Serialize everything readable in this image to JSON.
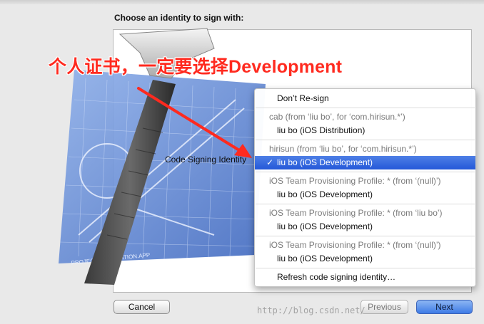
{
  "dialog": {
    "heading": "Choose an identity to sign with:",
    "field_label": "Code Signing Identity",
    "buttons": {
      "cancel": "Cancel",
      "previous": "Previous",
      "next": "Next"
    }
  },
  "annotation": {
    "text": "个人证书，一定要选择Development",
    "color": "#ff2a1f"
  },
  "menu": {
    "items": [
      {
        "kind": "option",
        "label": "Don’t Re-sign"
      },
      {
        "kind": "separator"
      },
      {
        "kind": "header",
        "label": "cab (from ‘liu bo’, for ‘com.hirisun.*’)"
      },
      {
        "kind": "option",
        "label": "liu bo (iOS Distribution)"
      },
      {
        "kind": "separator"
      },
      {
        "kind": "header",
        "label": "hirisun (from ‘liu bo’, for ‘com.hirisun.*’)"
      },
      {
        "kind": "selected",
        "label": "liu bo (iOS Development)",
        "check": "✓"
      },
      {
        "kind": "separator"
      },
      {
        "kind": "header",
        "label": "iOS Team Provisioning Profile: * (from ‘(null)’)"
      },
      {
        "kind": "option",
        "label": "liu bo (iOS Development)"
      },
      {
        "kind": "separator"
      },
      {
        "kind": "header",
        "label": "iOS Team Provisioning Profile: * (from ‘liu bo’)"
      },
      {
        "kind": "option",
        "label": "liu bo (iOS Development)"
      },
      {
        "kind": "separator"
      },
      {
        "kind": "header",
        "label": "iOS Team Provisioning Profile: * (from ‘(null)’)"
      },
      {
        "kind": "option",
        "label": "liu bo (iOS Development)"
      },
      {
        "kind": "separator"
      },
      {
        "kind": "option",
        "label": "Refresh code signing identity…"
      }
    ]
  },
  "background_art": {
    "blueprint_text": "PROJECT: APPLICATION.APP",
    "icon": "xcode-hammer-blueprint-icon"
  },
  "watermark": "http://blog.csdn.net/",
  "colors": {
    "highlight": "#2f63dc",
    "blueprint": "#4f78c8",
    "annotation": "#ff2a1f"
  }
}
